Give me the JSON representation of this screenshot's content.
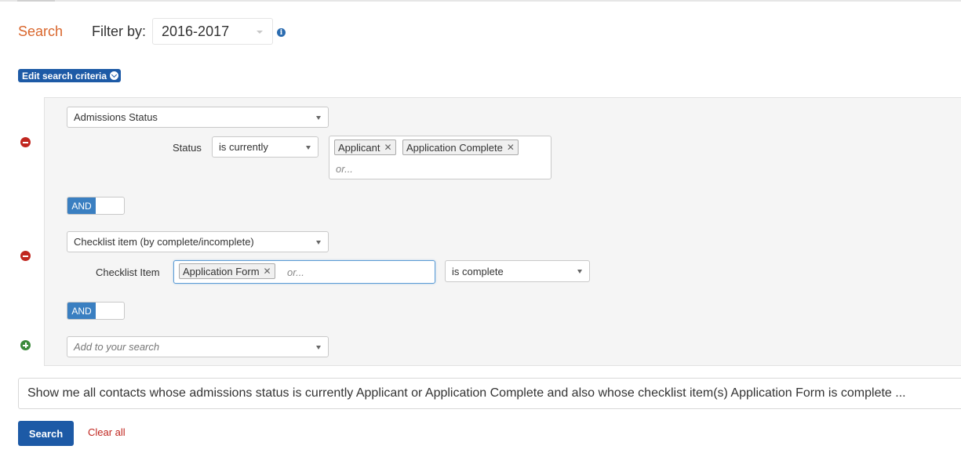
{
  "header": {
    "title": "Search",
    "filter_label": "Filter by:",
    "filter_value": "2016-2017",
    "info_icon": "info-icon"
  },
  "edit_criteria_label": "Edit search criteria",
  "criteria": [
    {
      "field": "Admissions Status",
      "sub_label": "Status",
      "operator": "is currently",
      "tags": [
        "Applicant",
        "Application Complete"
      ],
      "or_placeholder": "or..."
    },
    {
      "field": "Checklist item (by complete/incomplete)",
      "sub_label": "Checklist Item",
      "tags": [
        "Application Form"
      ],
      "or_placeholder": "or...",
      "condition": "is complete"
    }
  ],
  "connector_label": "AND",
  "add_placeholder": "Add to your search",
  "summary": "Show me all contacts whose admissions status is currently Applicant or Application Complete and also whose checklist item(s) Application Form is complete ...",
  "buttons": {
    "search": "Search",
    "clear_all": "Clear all"
  },
  "colors": {
    "accent_orange": "#d9662c",
    "primary_blue": "#1d5aa6",
    "toggle_blue": "#3a7fc1",
    "remove_red": "#c0261f",
    "add_green": "#3a8a3a"
  }
}
